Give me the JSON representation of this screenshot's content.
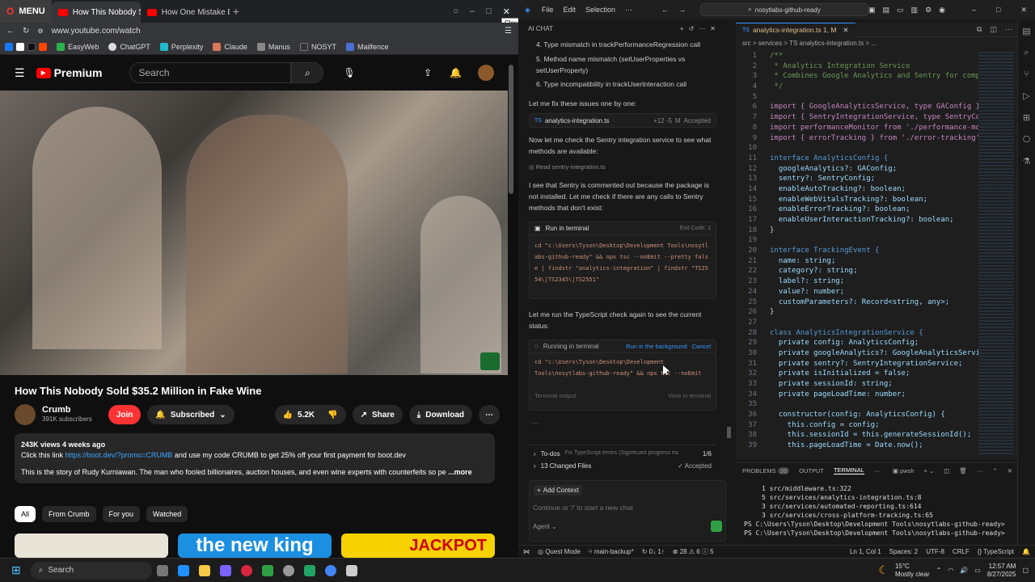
{
  "browser": {
    "menu_label": "MENU",
    "tabs": [
      {
        "label": "How This Nobody Sold"
      },
      {
        "label": "How One Mistake Broke"
      }
    ],
    "close_tooltip": "Close",
    "url": "www.youtube.com/watch",
    "bookmarks": [
      "EasyWeb",
      "ChatGPT",
      "Perplexity",
      "Claude",
      "Manus",
      "NOSYT",
      "Mailfence"
    ]
  },
  "youtube": {
    "logo_text": "Premium",
    "search_placeholder": "Search",
    "video_title": "How This Nobody Sold $35.2 Million in Fake Wine",
    "channel_name": "Crumb",
    "subscribers": "391K subscribers",
    "join_label": "Join",
    "subscribed_label": "Subscribed",
    "likes": "5.2K",
    "share_label": "Share",
    "download_label": "Download",
    "desc_meta": "243K views  4 weeks ago",
    "desc_line1_prefix": "Click this link",
    "desc_link": "https://boot.dev/?promo=CRUMB",
    "desc_line1_suffix": "and use my code  CRUMB  to get 25% off your first payment for boot.dev",
    "desc_line2": "This is the story of Rudy Kurniawan. The man who fooled billionaires, auction houses, and even wine experts with counterfeits so pe",
    "more_label": "...more",
    "chips": [
      "All",
      "From Crumb",
      "For you",
      "Watched"
    ],
    "thumb_text_1": "the new king",
    "thumb_text_2": "JACKPOT"
  },
  "vscode": {
    "menus": [
      "File",
      "Edit",
      "Selection"
    ],
    "title_search": "nosytlabs-github-ready",
    "chat_header": "AI CHAT",
    "chat": {
      "list_items": [
        "4. Type mismatch in trackPerformanceRegression call",
        "5. Method name mismatch (setUserProperties vs setUserProperty)",
        "6. Type incompatibility in trackUserInteraction call"
      ],
      "fix_text": "Let me fix these issues one by one:",
      "file_chip_name": "analytics-integration.ts",
      "file_chip_diff": "+12 -5",
      "file_chip_status": "Accepted",
      "check_text": "Now let me check the Sentry integration service to see what methods are available:",
      "read_text": "Read sentry-integration.ts",
      "sentry_text": "I see that Sentry is commented out because the package is not installed. Let me check if there are any calls to Sentry methods that don't exist:",
      "run_title": "Run in terminal",
      "exit_code": "Exit Code: 1",
      "cmd1": "cd \"c:\\Users\\Tyson\\Desktop\\Development Tools\\nosytlabs-github-ready\" && npx tsc --noEmit --pretty false | findstr \"analytics-integration\" | findstr \"TS2554\\|TS2345\\|TS2551\"",
      "rerun_text": "Let me run the TypeScript check again to see the current status:",
      "running_title": "Running in terminal",
      "run_bg": "Run in the background",
      "cancel": "Cancel",
      "cmd2": "cd \"c:\\Users\\Tyson\\Desktop\\Development Tools\\nosytlabs-github-ready\" && npx tsc --noEmit",
      "terminal_output": "Terminal output",
      "view_terminal": "View in terminal",
      "todos_label": "To-dos",
      "todos_text": "Fix TypeScript errors (Significant progress ma...",
      "todos_count": "1/6",
      "changed_files": "13 Changed Files",
      "changed_status": "Accepted",
      "add_context": "Add Context",
      "input_placeholder": "Continue or '/' to start a new chat",
      "agent_label": "Agent"
    },
    "editor_tab": "analytics-integration.ts 1, M",
    "breadcrumb": "src > services > TS analytics-integration.ts > ...",
    "code": [
      {
        "n": "1",
        "t": "/**"
      },
      {
        "n": "2",
        "t": " * Analytics Integration Service"
      },
      {
        "n": "3",
        "t": " * Combines Google Analytics and Sentry for compr"
      },
      {
        "n": "4",
        "t": " */"
      },
      {
        "n": "5",
        "t": ""
      },
      {
        "n": "6",
        "t": "import { GoogleAnalyticsService, type GAConfig }"
      },
      {
        "n": "7",
        "t": "import { SentryIntegrationService, type SentryCon"
      },
      {
        "n": "8",
        "t": "import performanceMonitor from './performance-mon"
      },
      {
        "n": "9",
        "t": "import { errorTracking } from './error-tracking';"
      },
      {
        "n": "10",
        "t": ""
      },
      {
        "n": "11",
        "t": "interface AnalyticsConfig {"
      },
      {
        "n": "12",
        "t": "  googleAnalytics?: GAConfig;"
      },
      {
        "n": "13",
        "t": "  sentry?: SentryConfig;"
      },
      {
        "n": "14",
        "t": "  enableAutoTracking?: boolean;"
      },
      {
        "n": "15",
        "t": "  enableWebVitalsTracking?: boolean;"
      },
      {
        "n": "16",
        "t": "  enableErrorTracking?: boolean;"
      },
      {
        "n": "17",
        "t": "  enableUserInteractionTracking?: boolean;"
      },
      {
        "n": "18",
        "t": "}"
      },
      {
        "n": "19",
        "t": ""
      },
      {
        "n": "20",
        "t": "interface TrackingEvent {"
      },
      {
        "n": "21",
        "t": "  name: string;"
      },
      {
        "n": "22",
        "t": "  category?: string;"
      },
      {
        "n": "23",
        "t": "  label?: string;"
      },
      {
        "n": "24",
        "t": "  value?: number;"
      },
      {
        "n": "25",
        "t": "  customParameters?: Record<string, any>;"
      },
      {
        "n": "26",
        "t": "}"
      },
      {
        "n": "27",
        "t": ""
      },
      {
        "n": "28",
        "t": "class AnalyticsIntegrationService {"
      },
      {
        "n": "29",
        "t": "  private config: AnalyticsConfig;"
      },
      {
        "n": "30",
        "t": "  private googleAnalytics?: GoogleAnalyticsServic"
      },
      {
        "n": "31",
        "t": "  private sentry?: SentryIntegrationService;"
      },
      {
        "n": "32",
        "t": "  private isInitialized = false;"
      },
      {
        "n": "33",
        "t": "  private sessionId: string;"
      },
      {
        "n": "34",
        "t": "  private pageLoadTime: number;"
      },
      {
        "n": "35",
        "t": ""
      },
      {
        "n": "36",
        "t": "  constructor(config: AnalyticsConfig) {"
      },
      {
        "n": "37",
        "t": "    this.config = config;"
      },
      {
        "n": "38",
        "t": "    this.sessionId = this.generateSessionId();"
      },
      {
        "n": "39",
        "t": "    this.pageLoadTime = Date.now();"
      }
    ],
    "terminal_tabs": [
      "PROBLEMS",
      "OUTPUT",
      "TERMINAL"
    ],
    "problems_count": "39",
    "shell_label": "pwsh",
    "terminal_lines": [
      "1  src/middleware.ts:322",
      "5  src/services/analytics-integration.ts:8",
      "3  src/services/automated-reporting.ts:614",
      "3  src/services/cross-platform-tracking.ts:65",
      "PS C:\\Users\\Tyson\\Desktop\\Development Tools\\nosytlabs-github-ready>",
      "PS C:\\Users\\Tyson\\Desktop\\Development Tools\\nosytlabs-github-ready>"
    ],
    "status": {
      "quest": "Quest Mode",
      "branch": "main-backup*",
      "sync": "0↓ 1↑",
      "problems": "28",
      "warnings": "6",
      "info": "5",
      "position": "Ln 1, Col 1",
      "spaces": "Spaces: 2",
      "encoding": "UTF-8",
      "eol": "CRLF",
      "language": "TypeScript"
    }
  },
  "taskbar": {
    "search_label": "Search",
    "weather": "15°C",
    "weather_desc": "Mostly clear",
    "time": "12:57 AM",
    "date": "8/27/2025"
  },
  "colors": {
    "yt_red": "#ff0000",
    "accent_blue": "#3794ff",
    "accepted_green": "#89d185"
  }
}
